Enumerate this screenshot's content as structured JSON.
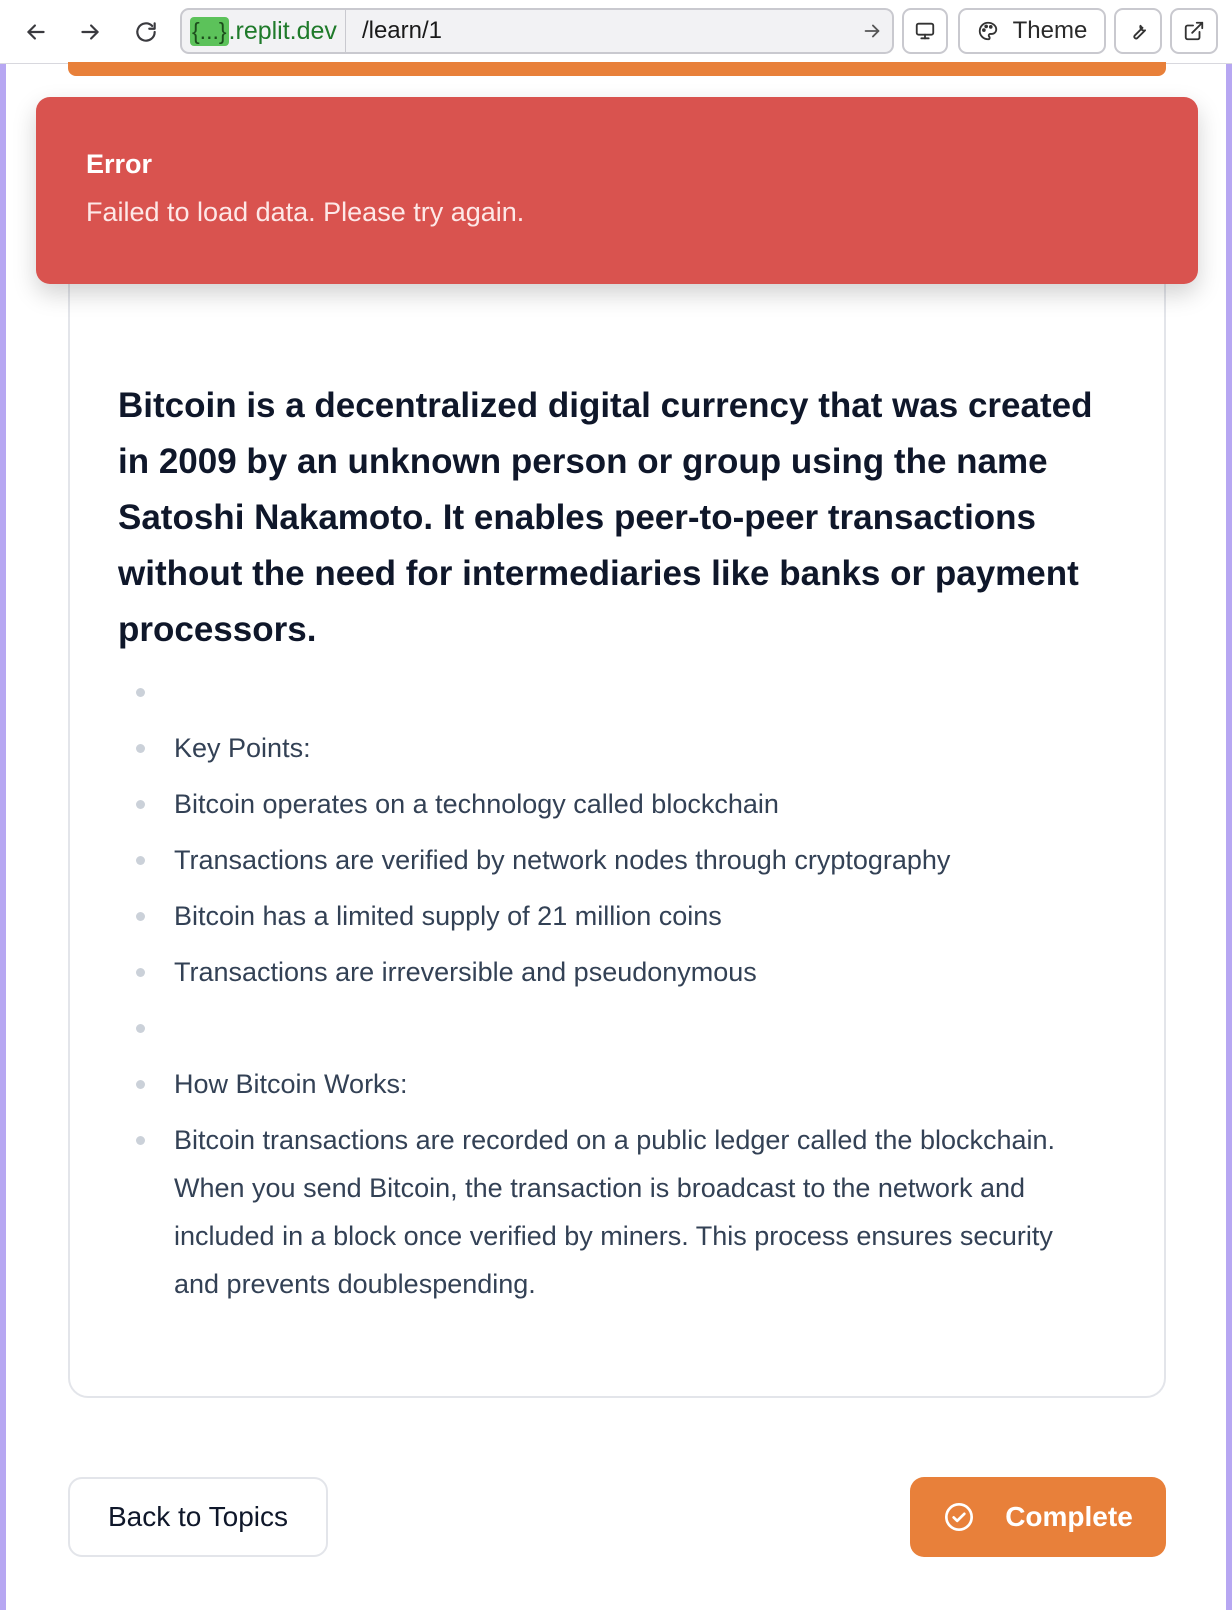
{
  "browser": {
    "url_host_badge": "{...}",
    "url_host_suffix": ".replit.dev",
    "url_path": "/learn/1",
    "theme_label": "Theme"
  },
  "error_toast": {
    "title": "Error",
    "message": "Failed to load data. Please try again."
  },
  "lesson": {
    "intro": "Bitcoin is a decentralized digital currency that was created in 2009 by an unknown person or group using the name Satoshi Nakamoto. It enables peer-to-peer transactions without the need for intermediaries like banks or payment processors.",
    "items": [
      "",
      "Key Points:",
      "Bitcoin operates on a technology called blockchain",
      "Transactions are verified by network nodes through cryptography",
      "Bitcoin has a limited supply of 21 million coins",
      "Transactions are irreversible and pseudonymous",
      "",
      "How Bitcoin Works:",
      "Bitcoin transactions are recorded on a public ledger called the blockchain. When you send Bitcoin, the transaction is broadcast to the network and included in a block once verified by miners. This process ensures security and prevents doublespending."
    ]
  },
  "footer": {
    "back_label": "Back to Topics",
    "complete_label": "Complete"
  },
  "colors": {
    "accent": "#e8803a",
    "error": "#d9534f"
  }
}
